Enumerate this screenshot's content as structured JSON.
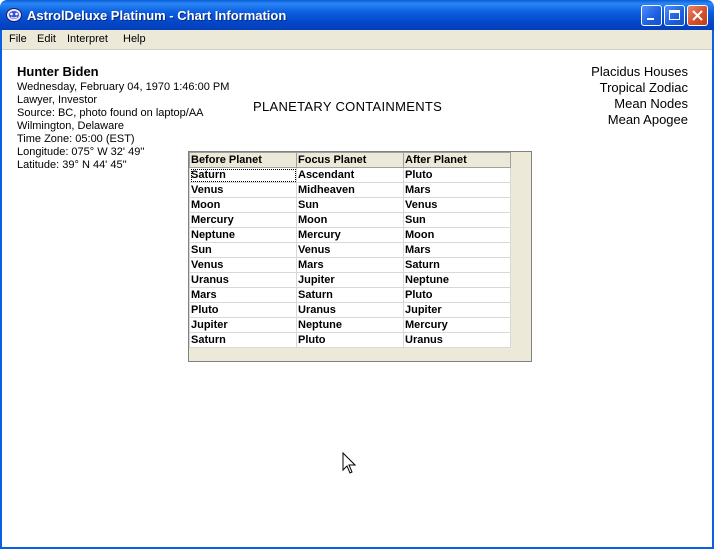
{
  "window": {
    "title": "AstrolDeluxe Platinum - Chart Information",
    "controls": [
      "minimize",
      "maximize",
      "close"
    ]
  },
  "menu": [
    "File",
    "Edit",
    "Interpret",
    "Help"
  ],
  "person": {
    "name": "Hunter Biden",
    "datetime": "Wednesday, February 04, 1970  1:46:00 PM",
    "occupation": "Lawyer, Investor",
    "source": "Source: BC, photo found on laptop/AA",
    "location": "Wilmington, Delaware",
    "timezone": "Time Zone: 05:00 (EST)",
    "longitude": "Longitude: 075° W 32' 49''",
    "latitude": "Latitude: 39° N 44' 45''"
  },
  "settings": {
    "houses": "Placidus Houses",
    "zodiac": "Tropical Zodiac",
    "nodes": "Mean Nodes",
    "apogee": "Mean Apogee"
  },
  "section_title": "PLANETARY CONTAINMENTS",
  "table": {
    "headers": [
      "Before Planet",
      "Focus Planet",
      "After Planet"
    ],
    "rows": [
      [
        "Saturn",
        "Ascendant",
        "Pluto"
      ],
      [
        "Venus",
        "Midheaven",
        "Mars"
      ],
      [
        "Moon",
        "Sun",
        "Venus"
      ],
      [
        "Mercury",
        "Moon",
        "Sun"
      ],
      [
        "Neptune",
        "Mercury",
        "Moon"
      ],
      [
        "Sun",
        "Venus",
        "Mars"
      ],
      [
        "Venus",
        "Mars",
        "Saturn"
      ],
      [
        "Uranus",
        "Jupiter",
        "Neptune"
      ],
      [
        "Mars",
        "Saturn",
        "Pluto"
      ],
      [
        "Pluto",
        "Uranus",
        "Jupiter"
      ],
      [
        "Jupiter",
        "Neptune",
        "Mercury"
      ],
      [
        "Saturn",
        "Pluto",
        "Uranus"
      ]
    ]
  },
  "colors": {
    "titlebar": "#0b5fe0",
    "menubar": "#ece9d8",
    "close_button": "#d4502c"
  }
}
